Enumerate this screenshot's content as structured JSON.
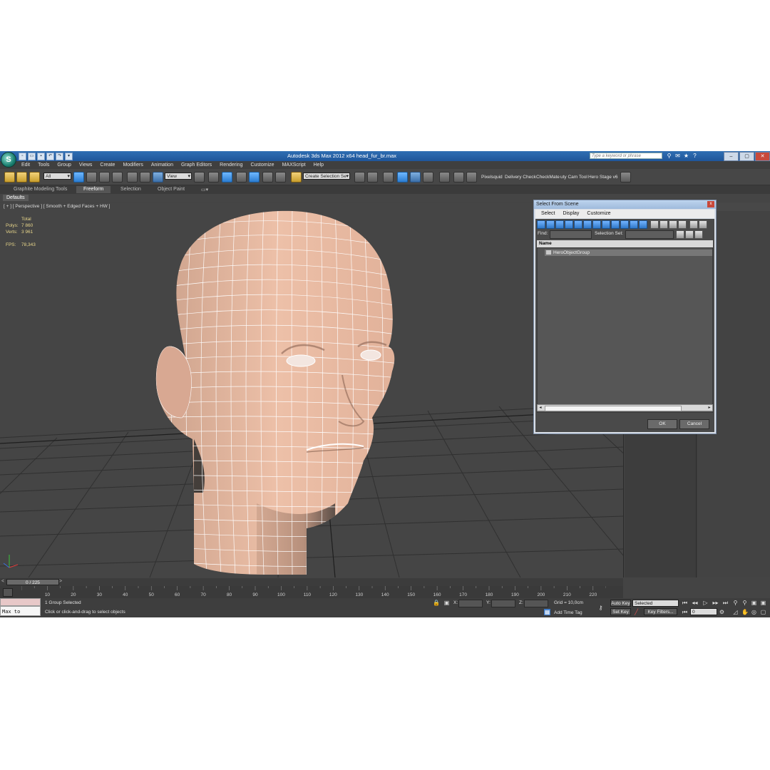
{
  "titlebar": {
    "title": "Autodesk 3ds Max  2012 x64      head_fur_br.max",
    "search_placeholder": "Type a keyword or phrase",
    "logo_letter": "S"
  },
  "menu": [
    "Edit",
    "Tools",
    "Group",
    "Views",
    "Create",
    "Modifiers",
    "Animation",
    "Graph Editors",
    "Rendering",
    "Customize",
    "MAXScript",
    "Help"
  ],
  "toolbar": {
    "filter_value": "All",
    "coord_value": "View",
    "selection_set_value": "Create Selection Se",
    "labels": [
      "Pixelsquid",
      "Delivery Check",
      "CheckMate",
      "uty Cam Tool",
      "Hero Stage v6"
    ]
  },
  "ribbon": {
    "tabs": [
      "Graphite Modeling Tools",
      "Freeform",
      "Selection",
      "Object Paint"
    ],
    "active": "Freeform",
    "sub_tab": "Defaults"
  },
  "viewport": {
    "label": "[ + ] [ Perspective ] [ Smooth + Edged Faces + HW ]",
    "stats": {
      "total_label": "Total",
      "polys_label": "Polys:",
      "polys_value": "7 860",
      "verts_label": "Verts:",
      "verts_value": "3 961",
      "fps_label": "FPS:",
      "fps_value": "78,343"
    }
  },
  "dialog": {
    "title": "Select From Scene",
    "close": "x",
    "menu": [
      "Select",
      "Display",
      "Customize"
    ],
    "find_label": "Find:",
    "selection_set_label": "Selection Set:",
    "column_header": "Name",
    "items": [
      "HeroObjectGroup"
    ],
    "ok_label": "OK",
    "cancel_label": "Cancel"
  },
  "timeline": {
    "slider_text": "0 / 225",
    "frame_labels": [
      "10",
      "20",
      "30",
      "40",
      "50",
      "60",
      "70",
      "80",
      "90",
      "100",
      "110",
      "120",
      "130",
      "140",
      "150",
      "160",
      "170",
      "180",
      "190",
      "200",
      "210",
      "220"
    ]
  },
  "statusbar": {
    "maxscript_text": "Max to Physc.",
    "selection_status": "1 Group Selected",
    "prompt": "Click or click-and-drag to select objects",
    "x_label": "X:",
    "y_label": "Y:",
    "z_label": "Z:",
    "grid_text": "Grid = 10,0cm",
    "add_time_tag": "Add Time Tag",
    "auto_key": "Auto Key",
    "selected_value": "Selected",
    "set_key": "Set Key",
    "key_filters": "Key Filters...",
    "frame_value": "0"
  },
  "colors": {
    "titlebar_blue": "#2a65ad",
    "viewport_bg": "#454545",
    "skin": "#e6b49c",
    "stats_yellow": "#e8d68a"
  }
}
